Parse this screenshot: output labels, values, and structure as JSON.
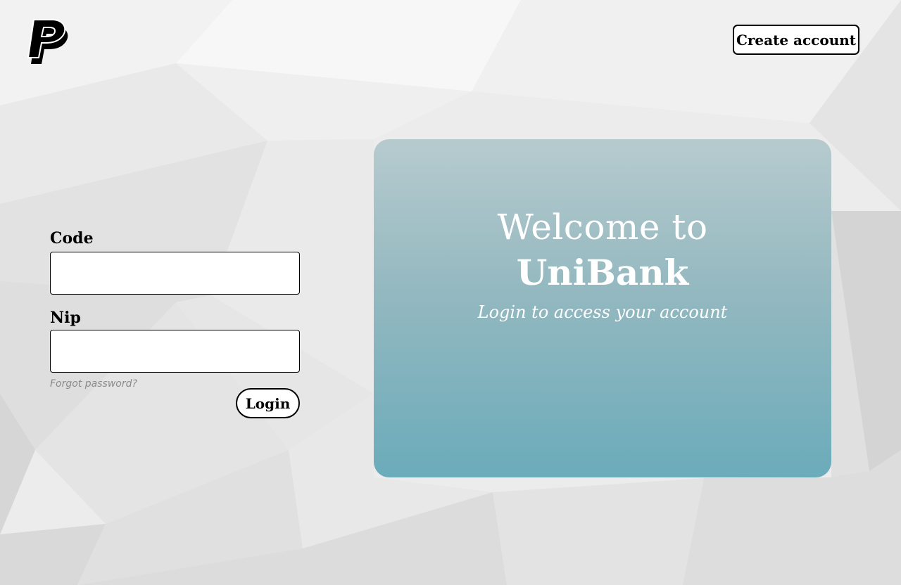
{
  "header": {
    "logo_icon": "paypal-logo-icon",
    "create_account_label": "Create account"
  },
  "login_form": {
    "code_label": "Code",
    "code_value": "",
    "nip_label": "Nip",
    "nip_value": "",
    "forgot_password_label": "Forgot password?",
    "login_button_label": "Login"
  },
  "welcome_card": {
    "welcome_line": "Welcome to",
    "brand_name": "UniBank",
    "tagline": "Login to access your account",
    "gradient_top": "#b2c8cc",
    "gradient_bottom": "#64a8b8"
  }
}
